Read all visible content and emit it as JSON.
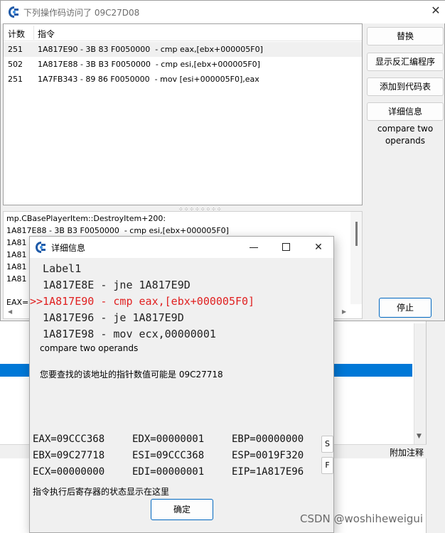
{
  "main_window": {
    "title": "下列操作码访问了 09C27D08",
    "columns": {
      "count": "计数",
      "instruction": "指令"
    },
    "rows": [
      {
        "count": "251",
        "instruction": "1A817E90 - 3B 83 F0050000  - cmp eax,[ebx+000005F0]",
        "selected": true
      },
      {
        "count": "502",
        "instruction": "1A817E88 - 3B B3 F0050000  - cmp esi,[ebx+000005F0]",
        "selected": false
      },
      {
        "count": "251",
        "instruction": "1A7FB343 - 89 86 F0050000  - mov [esi+000005F0],eax",
        "selected": false
      }
    ],
    "info_lines": [
      "mp.CBasePlayerItem::DestroyItem+200:",
      "1A817E88 - 3B B3 F0050000  - cmp esi,[ebx+000005F0]",
      "1A81",
      "1A81",
      "1A81",
      "1A81",
      "EAX=("
    ],
    "buttons": {
      "replace": "替换",
      "show_disassembler": "显示反汇编程序",
      "add_to_codelist": "添加到代码表",
      "more_info": "详细信息",
      "stop": "停止"
    },
    "description": "compare two operands"
  },
  "background": {
    "footer_label": "附加注释"
  },
  "detail_dialog": {
    "title": "详细信息",
    "code_lines": [
      {
        "text": "  Label1",
        "current": false
      },
      {
        "text": "  1A817E8E - jne 1A817E9D",
        "current": false
      },
      {
        "text": ">>1A817E90 - cmp eax,[ebx+000005F0]",
        "current": true
      },
      {
        "text": "  1A817E96 - je 1A817E9D",
        "current": false
      },
      {
        "text": "  1A817E98 - mov ecx,00000001",
        "current": false
      }
    ],
    "opcode_description": "compare two operands",
    "pointer_hint": "您要查找的该地址的指针数值可能是 09C27718",
    "registers": [
      [
        "EAX=09CCC368",
        "EDX=00000001",
        "EBP=00000000"
      ],
      [
        "EBX=09C27718",
        "ESI=09CCC368",
        "ESP=0019F320"
      ],
      [
        "ECX=00000000",
        "EDI=00000001",
        "EIP=1A817E96"
      ]
    ],
    "s_button": "S",
    "f_button": "F",
    "footer_note": "指令执行后寄存器的状态显示在这里",
    "ok_button": "确定"
  },
  "watermark": "CSDN @woshiheweigui"
}
